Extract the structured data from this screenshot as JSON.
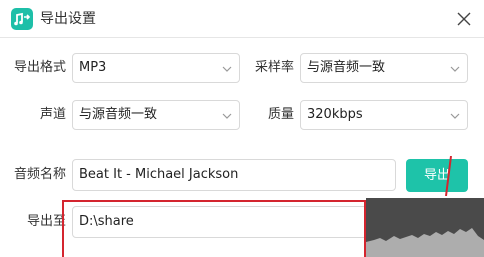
{
  "window": {
    "title": "导出设置",
    "icon": "music-export-icon",
    "accent_color": "#1ec3a9"
  },
  "form": {
    "format": {
      "label": "导出格式",
      "value": "MP3"
    },
    "sample_rate": {
      "label": "采样率",
      "value": "与源音频一致"
    },
    "channel": {
      "label": "声道",
      "value": "与源音频一致"
    },
    "quality": {
      "label": "质量",
      "value": "320kbps"
    },
    "audio_name": {
      "label": "音频名称",
      "value": "Beat It - Michael Jackson"
    },
    "export_to": {
      "label": "导出至",
      "value": "D:\\share"
    }
  },
  "buttons": {
    "export": "导出"
  }
}
